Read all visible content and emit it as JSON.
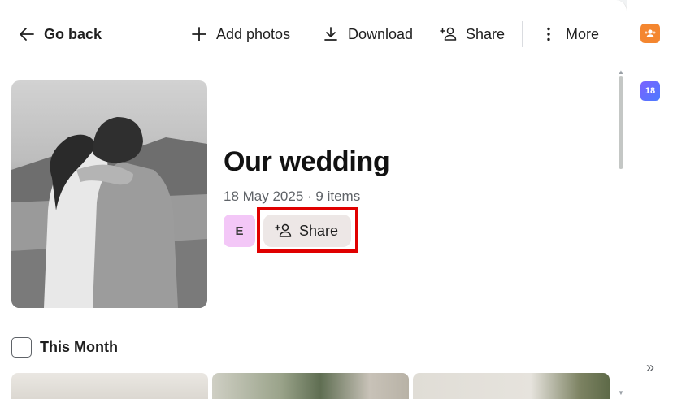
{
  "toolbar": {
    "go_back": "Go back",
    "add_photos": "Add photos",
    "download": "Download",
    "share": "Share",
    "more": "More"
  },
  "album": {
    "title": "Our wedding",
    "meta": "18 May 2025 · 9 items",
    "owner_initial": "E",
    "share_label": "Share"
  },
  "section": {
    "label": "This Month"
  },
  "side_rail": {
    "calendar_day": "18",
    "icons": [
      "contacts-icon",
      "calendar-icon",
      "expand-panel-icon"
    ]
  },
  "colors": {
    "highlight": "#e00000",
    "avatar_bg": "#f3c7f7",
    "share_button_bg": "#ede7e6",
    "contacts_icon": "#f4862f",
    "calendar_icon": "#6a6dff"
  }
}
